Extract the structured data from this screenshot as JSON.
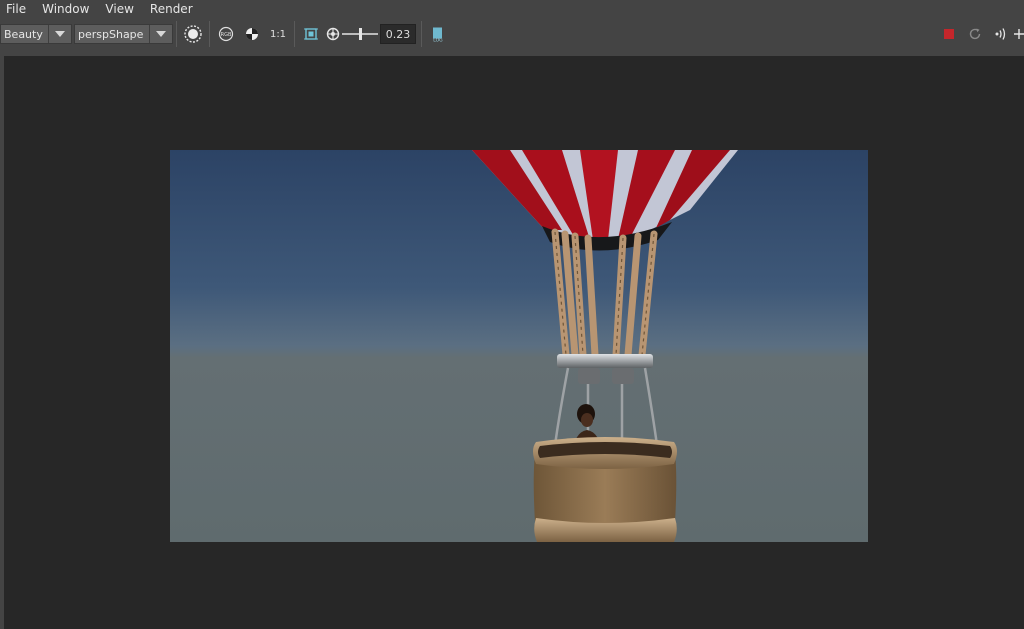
{
  "menu": {
    "file": "File",
    "window": "Window",
    "view": "View",
    "render": "Render"
  },
  "toolbar": {
    "pass_dropdown": "Beauty",
    "camera_dropdown": "perspShape",
    "ratio_label": "1:1",
    "exposure_value": "0.23",
    "exposure_level": 0.5,
    "icons": [
      "ipr-circle-icon",
      "rgb-channel-icon",
      "checker-icon",
      "frame-region-icon",
      "exposure-aperture-icon",
      "log-icon"
    ]
  },
  "right_toolbar": {
    "icons": [
      "stop-render-icon",
      "refresh-icon",
      "broadcast-icon",
      "crosshair-icon"
    ],
    "stop_color": "#c4262b"
  },
  "render_view": {
    "description_colors": {
      "sky_top": "#2d4466",
      "sky_horizon": "#5c6d7a",
      "ground": "#626e70",
      "balloon_red": "#a80f1c",
      "balloon_white": "#c7cbd9"
    }
  }
}
